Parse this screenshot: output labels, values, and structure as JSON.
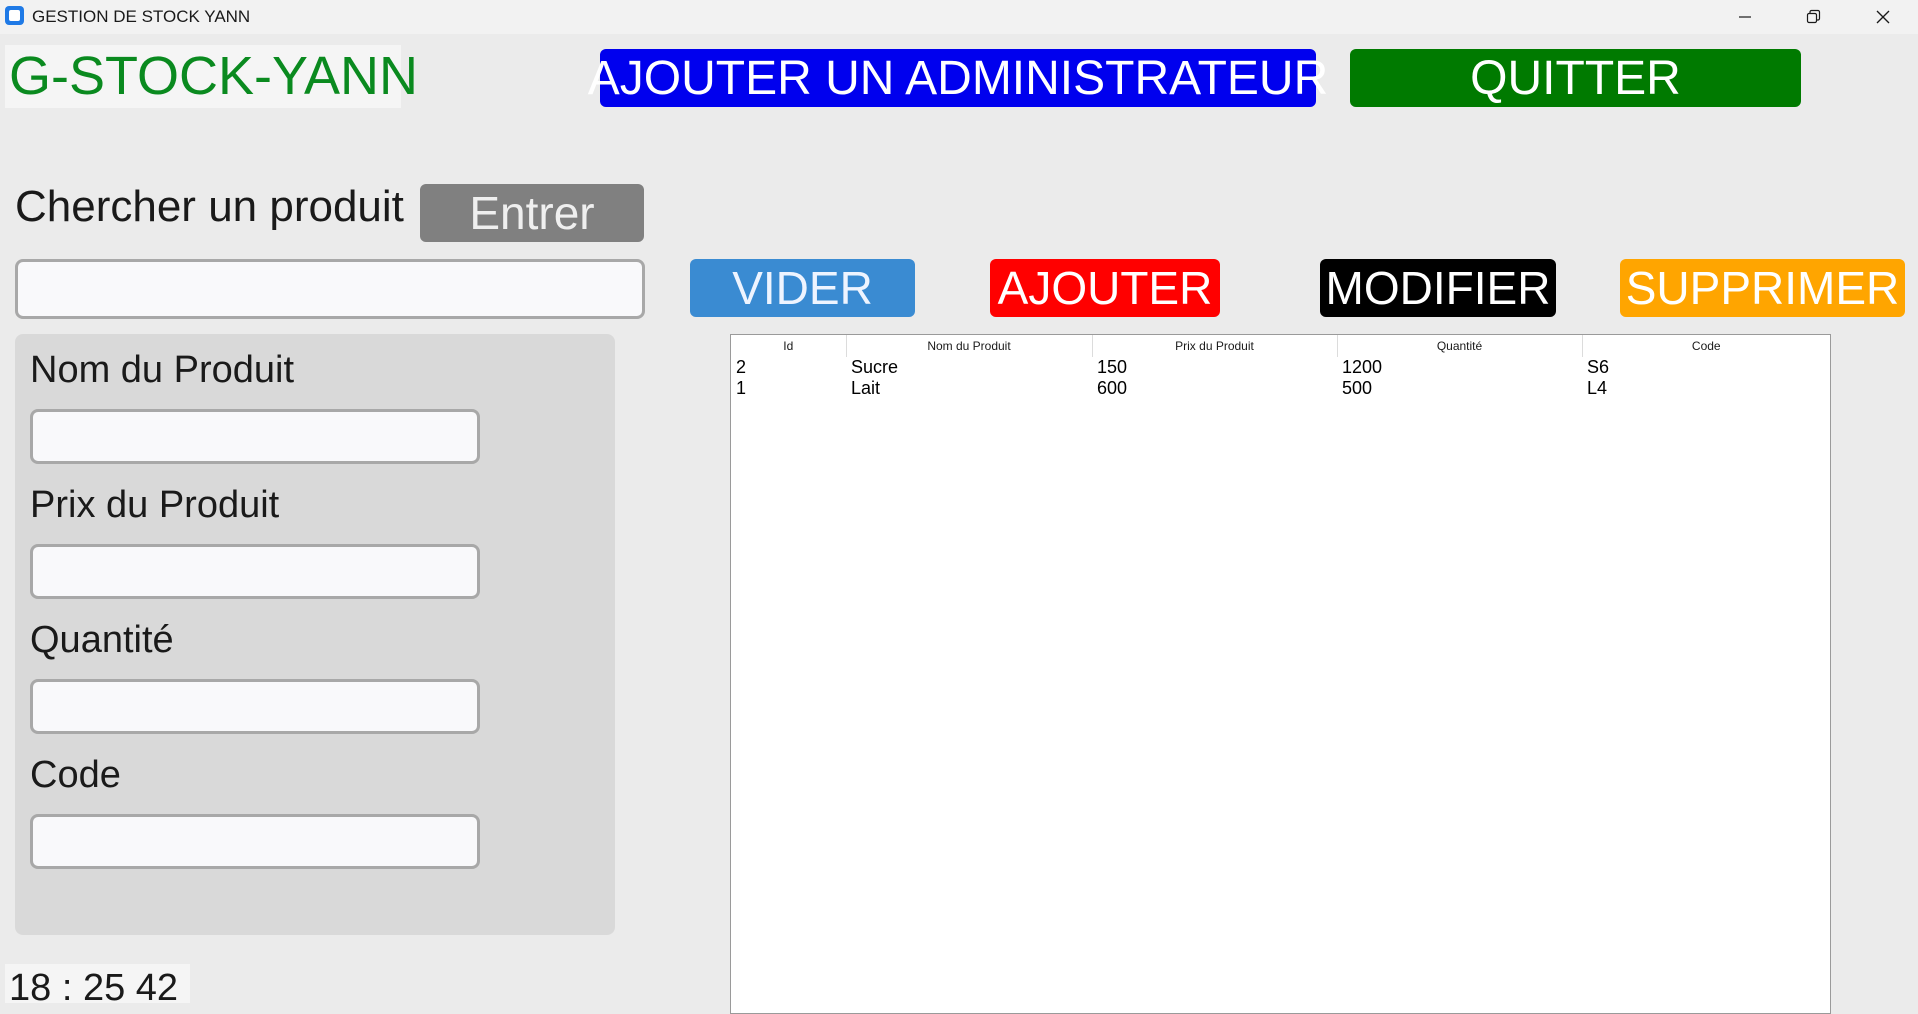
{
  "window": {
    "title": "GESTION DE STOCK YANN",
    "icons": {
      "app": "app-icon",
      "minimize": "minimize-icon",
      "restore": "restore-icon",
      "close": "close-icon"
    }
  },
  "header": {
    "logo": "G-STOCK-YANN",
    "add_admin_label": "AJOUTER UN ADMINISTRATEUR",
    "quit_label": "QUITTER"
  },
  "search": {
    "label": "Chercher un produit",
    "button_label": "Entrer",
    "value": ""
  },
  "actions": {
    "clear_label": "VIDER",
    "add_label": "AJOUTER",
    "edit_label": "MODIFIER",
    "delete_label": "SUPPRIMER"
  },
  "form": {
    "name_label": "Nom du Produit",
    "name_value": "",
    "price_label": "Prix du Produit",
    "price_value": "",
    "quantity_label": "Quantité",
    "quantity_value": "",
    "code_label": "Code",
    "code_value": ""
  },
  "table": {
    "columns": [
      "Id",
      "Nom du Produit",
      "Prix du Produit",
      "Quantité",
      "Code"
    ],
    "rows": [
      [
        "2",
        "Sucre",
        "150",
        "1200",
        "S6"
      ],
      [
        "1",
        "Lait",
        "600",
        "500",
        "L4"
      ]
    ]
  },
  "clock": {
    "text": "18 : 25  42"
  },
  "colors": {
    "logo_text": "#0a8a1f",
    "admin_button": "#0000ee",
    "quit_button": "#007a00",
    "enter_button": "#808080",
    "clear_button": "#3a8bd2",
    "add_button": "#ff0000",
    "edit_button": "#000000",
    "delete_button": "#ffa500"
  }
}
